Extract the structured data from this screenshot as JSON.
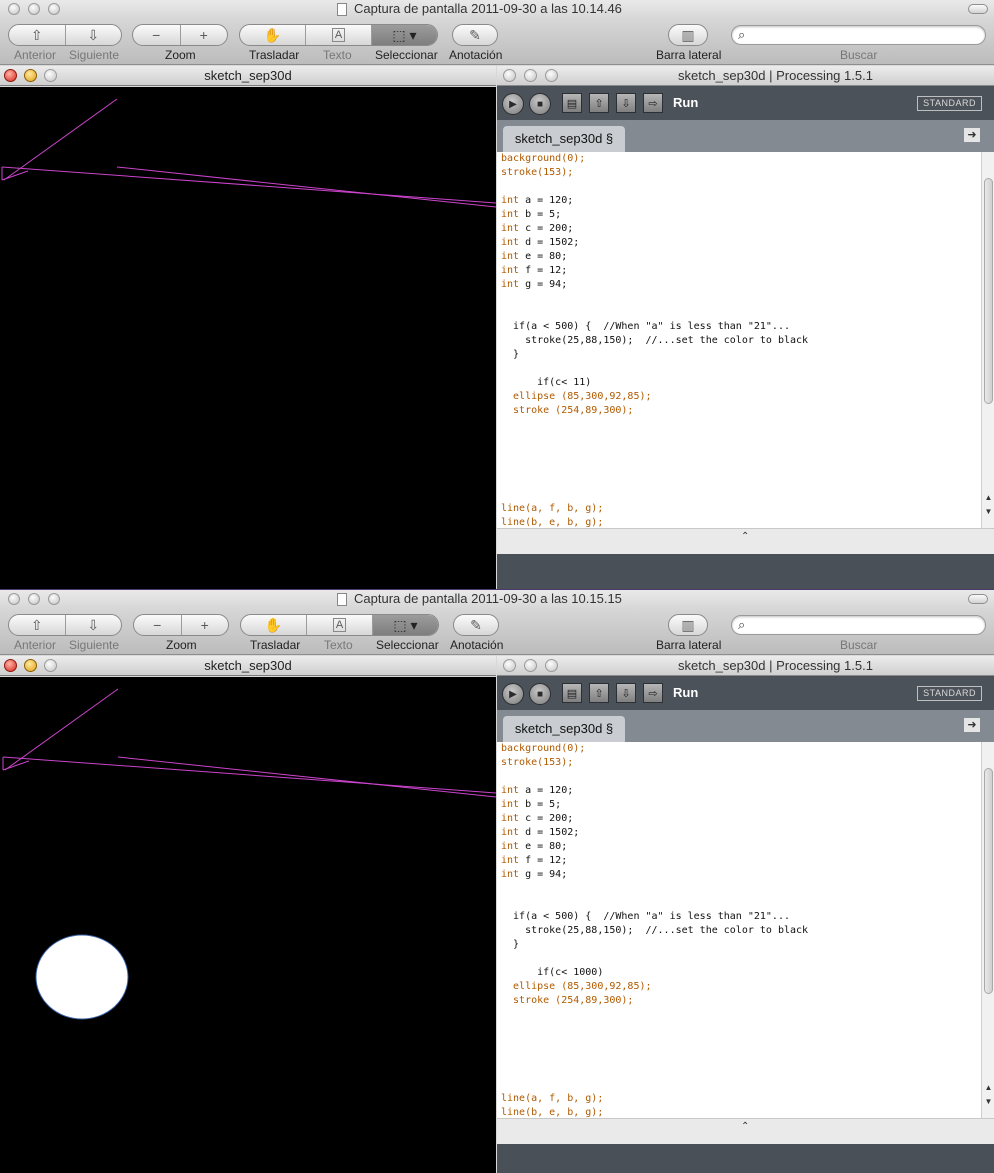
{
  "screenshots": [
    {
      "preview": {
        "title": "Captura de pantalla 2011-09-30 a las 10.14.46",
        "toolbar": {
          "anterior": "Anterior",
          "siguiente": "Siguiente",
          "zoom": "Zoom",
          "trasladar": "Trasladar",
          "texto": "Texto",
          "seleccionar": "Seleccionar",
          "anotacion": "Anotación",
          "barra_lateral": "Barra lateral",
          "buscar": "Buscar"
        }
      },
      "sketch": {
        "title": "sketch_sep30d",
        "show_ellipse": false
      },
      "ide": {
        "title": "sketch_sep30d | Processing 1.5.1",
        "run_label": "Run",
        "mode": "STANDARD",
        "tab": "sketch_sep30d §",
        "code_if_c": "11"
      }
    },
    {
      "preview": {
        "title": "Captura de pantalla 2011-09-30 a las 10.15.15",
        "toolbar": {
          "anterior": "Anterior",
          "siguiente": "Siguiente",
          "zoom": "Zoom",
          "trasladar": "Trasladar",
          "texto": "Texto",
          "seleccionar": "Seleccionar",
          "anotacion": "Anotación",
          "barra_lateral": "Barra lateral",
          "buscar": "Buscar"
        }
      },
      "sketch": {
        "title": "sketch_sep30d",
        "show_ellipse": true
      },
      "ide": {
        "title": "sketch_sep30d | Processing 1.5.1",
        "run_label": "Run",
        "mode": "STANDARD",
        "tab": "sketch_sep30d §",
        "code_if_c": "1000"
      }
    }
  ],
  "code": {
    "l1": "background(0);",
    "l2": "stroke(153);",
    "l3": "int a = 120;",
    "l4": "int b = 5;",
    "l5": "int c = 200;",
    "l6": "int d = 1502;",
    "l7": "int e = 80;",
    "l8": "int f = 12;",
    "l9": "int g = 94;",
    "l10": "  if(a < 500) {  //When \"a\" is less than \"21\"...",
    "l11": "    stroke(25,88,150);  //...set the color to black",
    "l12": "  }",
    "l13_prefix": "      if(c< ",
    "l13_suffix": ")",
    "l14": "  ellipse (85,300,92,85);",
    "l15": "  stroke (254,89,300);",
    "l16": "line(a, f, b, g);",
    "l17": "line(b, e, b, g);"
  },
  "colors": {
    "sketch_stroke": "#cc44cc",
    "editor_keyword": "#b05a00"
  }
}
